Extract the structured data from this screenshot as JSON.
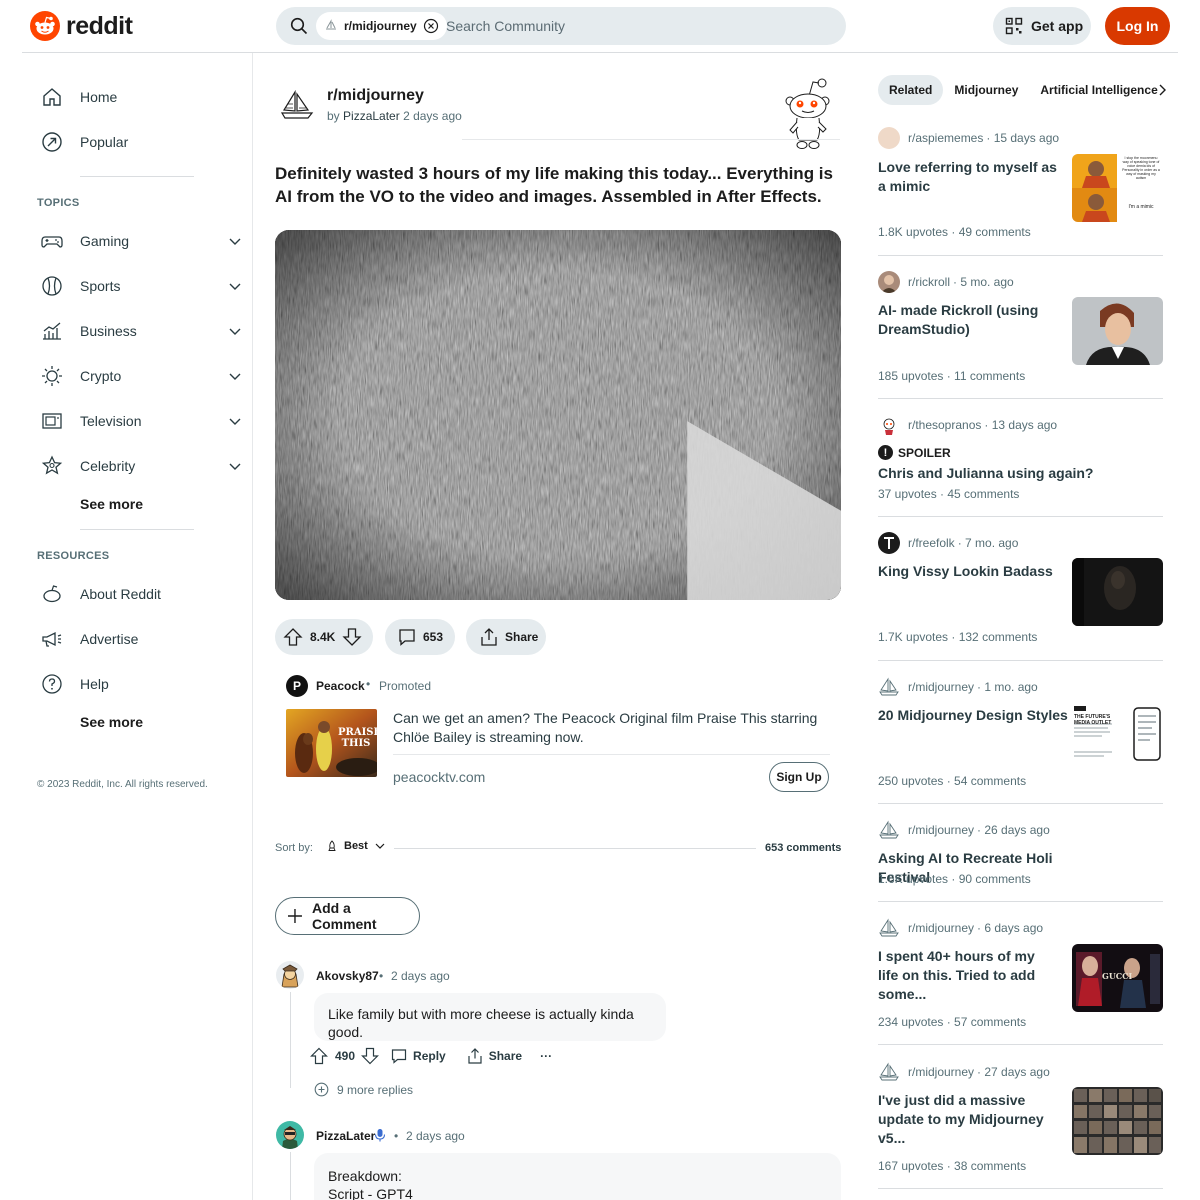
{
  "header": {
    "logo_text": "reddit",
    "search_chip": "r/midjourney",
    "search_placeholder": "Search Community",
    "get_app_label": "Get app",
    "login_label": "Log In"
  },
  "sidebar": {
    "primary": [
      {
        "label": "Home",
        "icon": "home-icon"
      },
      {
        "label": "Popular",
        "icon": "popular-icon"
      }
    ],
    "topics_title": "TOPICS",
    "topics": [
      {
        "label": "Gaming",
        "icon": "gaming-icon"
      },
      {
        "label": "Sports",
        "icon": "sports-icon"
      },
      {
        "label": "Business",
        "icon": "business-icon"
      },
      {
        "label": "Crypto",
        "icon": "crypto-icon"
      },
      {
        "label": "Television",
        "icon": "television-icon"
      },
      {
        "label": "Celebrity",
        "icon": "celebrity-icon"
      }
    ],
    "topics_see_more": "See more",
    "resources_title": "RESOURCES",
    "resources": [
      {
        "label": "About Reddit",
        "icon": "about-icon"
      },
      {
        "label": "Advertise",
        "icon": "advertise-icon"
      },
      {
        "label": "Help",
        "icon": "help-icon"
      }
    ],
    "resources_see_more": "See more",
    "copyright": "© 2023 Reddit, Inc. All rights reserved."
  },
  "post": {
    "subreddit": "r/midjourney",
    "by": "by",
    "author": "PizzaLater",
    "time": "2 days ago",
    "title": "Definitely wasted 3 hours of my life making this today... Everything is AI from the VO to the video and images. Assembled in After Effects.",
    "votes": "8.4K",
    "comments": "653",
    "share_label": "Share"
  },
  "ad": {
    "advertiser": "Peacock",
    "avatar_letter": "P",
    "separator": "•",
    "promoted_label": "Promoted",
    "thumb_text": "PRAISE THIS",
    "text": "Can we get an amen? The Peacock Original film Praise This starring Chlöe Bailey is streaming now.",
    "domain": "peacocktv.com",
    "cta": "Sign Up"
  },
  "sort": {
    "label": "Sort by:",
    "value": "Best",
    "count": "653 comments"
  },
  "add_comment_label": "Add a Comment",
  "comments": [
    {
      "author": "Akovsky87",
      "separator": "•",
      "time": "2 days ago",
      "body": "Like family but with more cheese is actually kinda good.",
      "votes": "490",
      "reply_label": "Reply",
      "share_label": "Share",
      "more_label": "···",
      "more_replies": "9 more replies"
    },
    {
      "author": "PizzaLater",
      "separator": "•",
      "time": "2 days ago",
      "body_lines": [
        "Breakdown:",
        "Script - GPT4"
      ]
    }
  ],
  "related": {
    "tabs": [
      "Related",
      "Midjourney",
      "Artificial Intelligence"
    ],
    "cards": [
      {
        "sub": "r/aspiememes",
        "time": "· 15 days ago",
        "title": "Love referring to myself as a mimic",
        "stats": "1.8K upvotes  ·  49 comments",
        "thumb_caption_1": "I stop the moonmenu way of speaking tone of voice demia ids of Personality in order as a way of masking my autism",
        "thumb_caption_2": "I'm a mimic"
      },
      {
        "sub": "r/rickroll",
        "time": "· 5 mo. ago",
        "title": "AI- made Rickroll (using DreamStudio)",
        "stats": "185 upvotes  ·  11 comments"
      },
      {
        "sub": "r/thesopranos",
        "time": "· 13 days ago",
        "spoiler": "SPOILER",
        "title": "Chris and Julianna using again?",
        "stats": "37 upvotes  ·  45 comments"
      },
      {
        "sub": "r/freefolk",
        "time": "· 7 mo. ago",
        "title": "King Vissy Lookin Badass",
        "stats": "1.7K upvotes  ·  132 comments"
      },
      {
        "sub": "r/midjourney",
        "time": "· 1 mo. ago",
        "title": "20 Midjourney Design Styles",
        "stats": "250 upvotes  ·  54 comments",
        "thumb_caption": "THE FUTURE'S MEDIA OUTLET"
      },
      {
        "sub": "r/midjourney",
        "time": "· 26 days ago",
        "title": "Asking AI to Recreate Holi Festival",
        "stats": "1.6K upvotes  ·  90 comments"
      },
      {
        "sub": "r/midjourney",
        "time": "· 6 days ago",
        "title": "I spent 40+ hours of my life on this. Tried to add some...",
        "stats": "234 upvotes  ·  57 comments",
        "thumb_caption": "GUCCI"
      },
      {
        "sub": "r/midjourney",
        "time": "· 27 days ago",
        "title": "I've just did a massive update to my Midjourney v5...",
        "stats": "167 upvotes  ·  38 comments"
      }
    ]
  },
  "colors": {
    "brand": "#ff4500",
    "login": "#d93900",
    "pill": "#e5ebee",
    "text_secondary": "#576f76"
  }
}
